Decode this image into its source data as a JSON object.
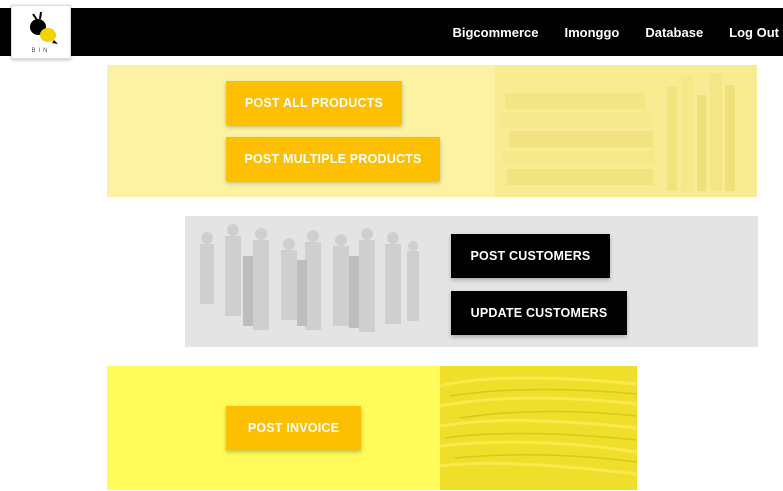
{
  "logo": {
    "text": "BIN",
    "icon": "bin-bee-logo-icon"
  },
  "nav": {
    "items": [
      {
        "label": "Bigcommerce"
      },
      {
        "label": "Imonggo"
      },
      {
        "label": "Database"
      },
      {
        "label": "Log Out"
      }
    ]
  },
  "products": {
    "post_all_label": "POST ALL PRODUCTS",
    "post_multiple_label": "POST MULTIPLE PRODUCTS"
  },
  "customers": {
    "post_label": "POST CUSTOMERS",
    "update_label": "UPDATE CUSTOMERS"
  },
  "invoice": {
    "post_label": "POST INVOICE"
  },
  "colors": {
    "navbar": "#000000",
    "accent_yellow": "#fcc000",
    "products_panel": "#fbf3a3",
    "customers_panel": "#e4e4e4",
    "invoice_panel": "#fffb5a"
  }
}
